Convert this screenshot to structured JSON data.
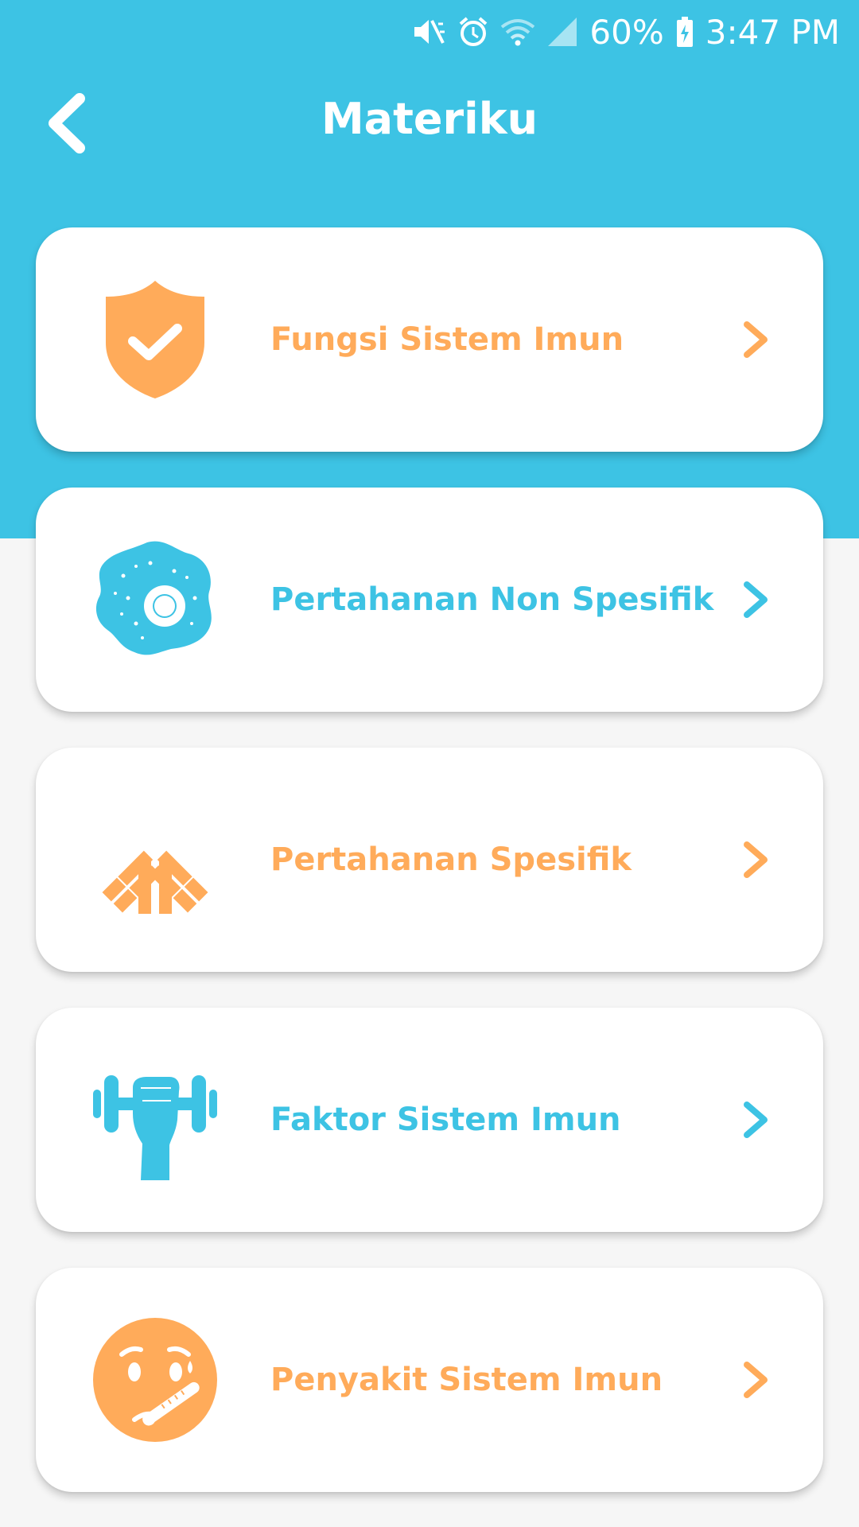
{
  "colors": {
    "header": "#3dc3e4",
    "orange": "#ffab5a",
    "blue": "#3dc3e4",
    "background": "#f6f6f6"
  },
  "status_bar": {
    "battery": "60%",
    "time": "3:47 PM",
    "icons": [
      "mute-vibrate-icon",
      "alarm-icon",
      "wifi-icon",
      "signal-icon",
      "battery-icon"
    ]
  },
  "header": {
    "title": "Materiku",
    "back_icon": "back-arrow-icon"
  },
  "menu": {
    "items": [
      {
        "label": "Fungsi Sistem Imun",
        "icon": "shield-check-icon",
        "color": "#ffab5a"
      },
      {
        "label": "Pertahanan Non Spesifik",
        "icon": "cell-icon",
        "color": "#3dc3e4"
      },
      {
        "label": "Pertahanan Spesifik",
        "icon": "antibody-icon",
        "color": "#ffab5a"
      },
      {
        "label": "Faktor Sistem Imun",
        "icon": "dumbbell-hand-icon",
        "color": "#3dc3e4"
      },
      {
        "label": "Penyakit Sistem Imun",
        "icon": "sick-face-icon",
        "color": "#ffab5a"
      }
    ]
  }
}
